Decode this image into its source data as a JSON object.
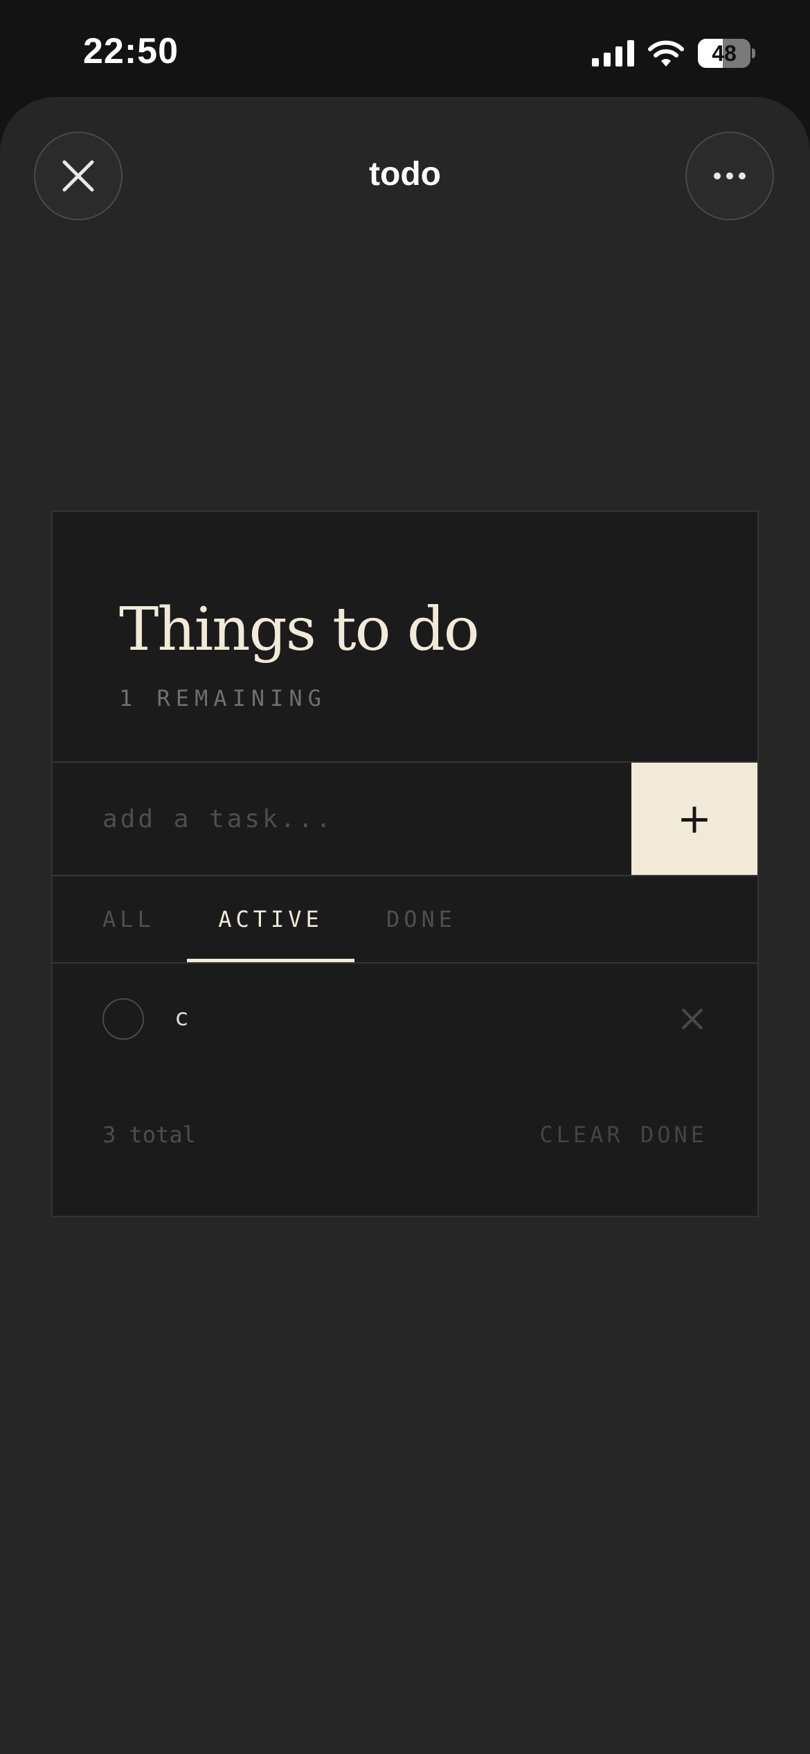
{
  "status_bar": {
    "time": "22:50",
    "battery_level": "48",
    "battery_fraction": 0.48
  },
  "header": {
    "title": "todo",
    "close_icon": "close-icon",
    "more_icon": "more-icon"
  },
  "card": {
    "title": "Things to do",
    "remaining": "1 REMAINING",
    "input": {
      "value": "",
      "placeholder": "add a task..."
    },
    "add_label": "+",
    "tabs": [
      {
        "label": "ALL",
        "active": false
      },
      {
        "label": "ACTIVE",
        "active": true
      },
      {
        "label": "DONE",
        "active": false
      }
    ],
    "tasks": [
      {
        "text": "c",
        "done": false
      }
    ],
    "footer": {
      "total": "3 total",
      "clear_label": "CLEAR DONE"
    }
  },
  "colors": {
    "accent": "#f1ead8",
    "sheet_bg": "#262626",
    "card_bg": "#1b1b1b"
  }
}
